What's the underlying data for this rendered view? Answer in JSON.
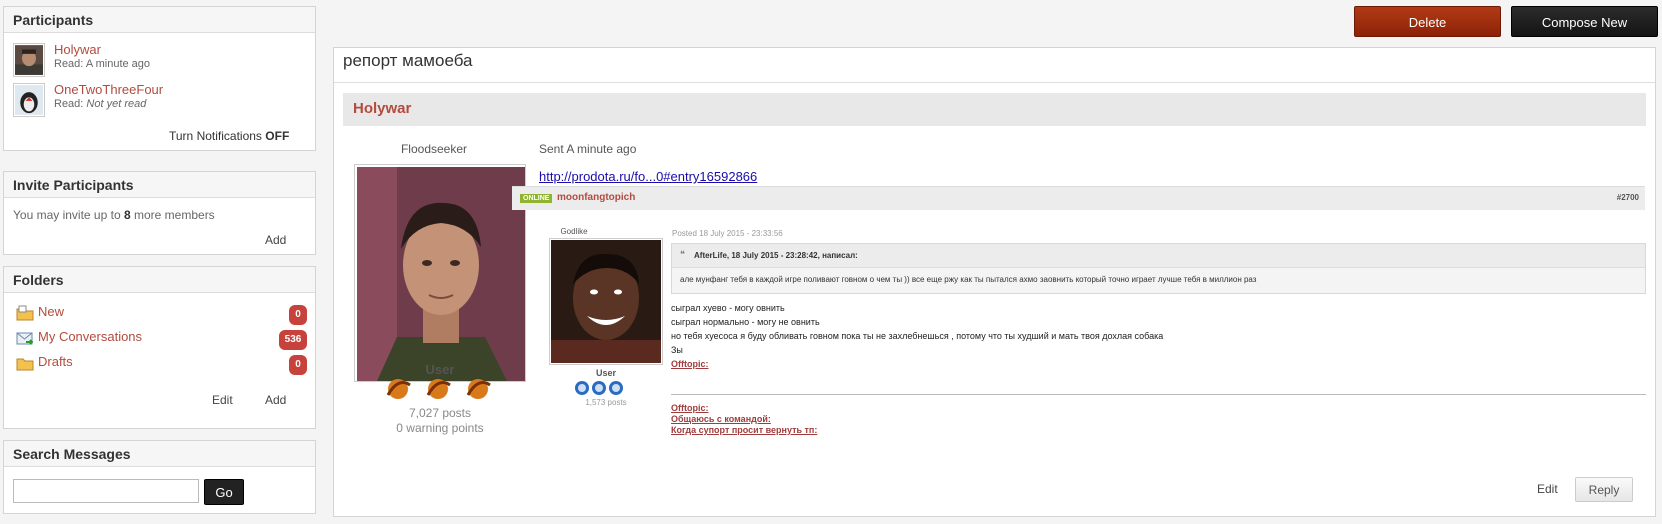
{
  "participants": {
    "title": "Participants",
    "list": [
      {
        "name": "Holywar",
        "read_label": "Read:",
        "read_value": "A minute ago"
      },
      {
        "name": "OneTwoThreeFour",
        "read_label": "Read:",
        "read_value": "Not yet read"
      }
    ],
    "notifications_label": "Turn Notifications",
    "notifications_state": "OFF"
  },
  "invite": {
    "title": "Invite Participants",
    "text_before": "You may invite up to",
    "count": "8",
    "text_after": "more members",
    "add_label": "Add"
  },
  "folders": {
    "title": "Folders",
    "items": [
      {
        "label": "New",
        "count": "0"
      },
      {
        "label": "My Conversations",
        "count": "536"
      },
      {
        "label": "Drafts",
        "count": "0"
      }
    ],
    "edit_label": "Edit",
    "add_label": "Add"
  },
  "search": {
    "title": "Search Messages",
    "value": "",
    "go_label": "Go"
  },
  "actions": {
    "delete_label": "Delete",
    "compose_label": "Compose New"
  },
  "conversation": {
    "title": "репорт мамоеба",
    "author_header": "Holywar",
    "sender": {
      "username": "Floodseeker",
      "role": "User",
      "posts": "7,027 posts",
      "warnings": "0 warning points"
    },
    "sent_label": "Sent A minute ago",
    "link_text": "http://prodota.ru/fo...0#entry16592866",
    "edit_label": "Edit",
    "reply_label": "Reply"
  },
  "embedded_post": {
    "status": "ONLINE",
    "author": "moonfangtopich",
    "post_number": "#2700",
    "rank": "Godlike",
    "posted": "Posted 18 July 2015 - 23:33:56",
    "role": "User",
    "posts": "1,573 posts",
    "quote_header": "AfterLife, 18 July 2015 - 23:28:42, написал:",
    "quote_text": "але мунфанг тебя в каждой игре поливают говном о чем ты )) все еще ржу как ты пытался ахмо заовнить который точно играет лучше тебя в миллион раз",
    "lines": [
      "сыграл хуево - могу овнить",
      "сыграл нормально - могу не овнить",
      "но тебя хуесоса я буду обливать говном пока ты не захлебнешься , потому что ты худший и мать твоя дохлая собака",
      "Зы"
    ],
    "offtopic_link": "Offtopic:",
    "signature_links": [
      "Offtopic:",
      "Общаюсь с командой:",
      "Когда супорт просит вернуть тп:"
    ]
  },
  "colors": {
    "accent_link": "#b34b3e",
    "delete_button": "#9a2a10",
    "compose_button": "#1e1e1e",
    "badge": "#c6423a",
    "online_badge": "#8fb52e",
    "post_link": "#1a0dab"
  }
}
